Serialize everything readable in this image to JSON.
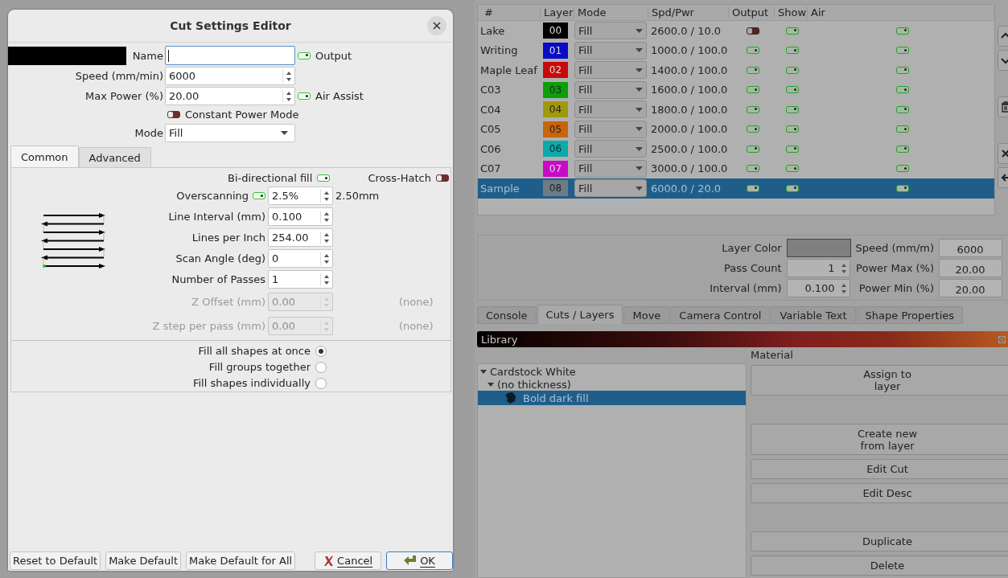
{
  "dialog": {
    "title": "Cut Settings Editor",
    "layer_swatch": {
      "color": "#000000"
    },
    "name": {
      "label": "Name"
    },
    "output": {
      "label": "Output",
      "on": true
    },
    "speed": {
      "label": "Speed (mm/min)",
      "value": "6000"
    },
    "max_power": {
      "label": "Max Power (%)",
      "value": "20.00"
    },
    "air_assist": {
      "label": "Air Assist",
      "on": true
    },
    "constant_power": {
      "label": "Constant Power Mode",
      "on": false
    },
    "mode": {
      "label": "Mode",
      "value": "Fill"
    },
    "tabs": [
      {
        "label": "Common",
        "selected": true
      },
      {
        "label": "Advanced",
        "selected": false
      }
    ],
    "bidirectional": {
      "label": "Bi-directional fill",
      "on": true
    },
    "cross_hatch": {
      "label": "Cross-Hatch",
      "on": false
    },
    "params": [
      {
        "label": "Overscanning",
        "value": "2.5%",
        "on": true,
        "suffix": "2.50mm",
        "disabled": false
      },
      {
        "label": "Line Interval (mm)",
        "value": "0.100",
        "disabled": false
      },
      {
        "label": "Lines per Inch",
        "value": "254.00",
        "disabled": false
      },
      {
        "label": "Scan Angle (deg)",
        "value": "0",
        "disabled": false
      },
      {
        "label": "Number of Passes",
        "value": "1",
        "disabled": false
      },
      {
        "label": "Z Offset (mm)",
        "value": "0.00",
        "note": "(none)",
        "disabled": true
      },
      {
        "label": "Z step per pass (mm)",
        "value": "0.00",
        "note": "(none)",
        "disabled": true
      }
    ],
    "fill_order": [
      {
        "label": "Fill all shapes at once",
        "selected": true
      },
      {
        "label": "Fill groups together",
        "selected": false
      },
      {
        "label": "Fill shapes individually",
        "selected": false
      }
    ],
    "buttons": [
      {
        "label": "Reset to Default",
        "kind": "plain"
      },
      {
        "label": "Make Default",
        "kind": "plain"
      },
      {
        "label": "Make Default for All",
        "kind": "plain"
      },
      {
        "label": "Cancel",
        "kind": "cancel"
      },
      {
        "label": "OK",
        "kind": "ok"
      }
    ]
  },
  "layers": {
    "columns": [
      "#",
      "Layer",
      "Mode",
      "Spd/Pwr",
      "Output",
      "Show",
      "Air"
    ],
    "rows": [
      {
        "name": "Lake",
        "layer": "00",
        "color": "#000000",
        "mode": "Fill",
        "spd_pwr": "2600.0 / 10.0",
        "output": false,
        "show": true,
        "air": true,
        "selected": false
      },
      {
        "name": "Writing",
        "layer": "01",
        "color": "#0a0ac8",
        "mode": "Fill",
        "spd_pwr": "1000.0 / 100.0",
        "output": true,
        "show": true,
        "air": true,
        "selected": false
      },
      {
        "name": "Maple Leaf",
        "layer": "02",
        "color": "#c80a0a",
        "mode": "Fill",
        "spd_pwr": "1400.0 / 100.0",
        "output": true,
        "show": true,
        "air": true,
        "selected": false
      },
      {
        "name": "C03",
        "layer": "03",
        "color": "#0aa00a",
        "mode": "Fill",
        "spd_pwr": "1600.0 / 100.0",
        "output": true,
        "show": true,
        "air": true,
        "selected": false
      },
      {
        "name": "C04",
        "layer": "04",
        "color": "#a09a0a",
        "mode": "Fill",
        "spd_pwr": "1800.0 / 100.0",
        "output": true,
        "show": true,
        "air": true,
        "selected": false
      },
      {
        "name": "C05",
        "layer": "05",
        "color": "#c8640a",
        "mode": "Fill",
        "spd_pwr": "2000.0 / 100.0",
        "output": true,
        "show": true,
        "air": true,
        "selected": false
      },
      {
        "name": "C06",
        "layer": "06",
        "color": "#0aaaaa",
        "mode": "Fill",
        "spd_pwr": "2500.0 / 100.0",
        "output": true,
        "show": true,
        "air": true,
        "selected": false
      },
      {
        "name": "C07",
        "layer": "07",
        "color": "#c80ac8",
        "mode": "Fill",
        "spd_pwr": "3000.0 / 100.0",
        "output": true,
        "show": true,
        "air": true,
        "selected": false
      },
      {
        "name": "Sample",
        "layer": "08",
        "color": "#6e7c88",
        "mode": "Fill",
        "spd_pwr": "6000.0 / 20.0",
        "output": true,
        "show": true,
        "air": true,
        "selected": true
      }
    ]
  },
  "layer_settings": {
    "layer_color": {
      "label": "Layer Color",
      "color": "#808080"
    },
    "fields": [
      {
        "label": "Speed (mm/m)",
        "value": "6000"
      },
      {
        "label": "Pass Count",
        "value": "1"
      },
      {
        "label": "Power Max (%)",
        "value": "20.00"
      },
      {
        "label": "Interval (mm)",
        "value": "0.100"
      },
      {
        "label": "Power Min (%)",
        "value": "20.00"
      }
    ]
  },
  "bottom_tabs": [
    {
      "label": "Console",
      "selected": false
    },
    {
      "label": "Cuts / Layers",
      "selected": true
    },
    {
      "label": "Move",
      "selected": false
    },
    {
      "label": "Camera Control",
      "selected": false
    },
    {
      "label": "Variable Text",
      "selected": false
    },
    {
      "label": "Shape Properties",
      "selected": false
    }
  ],
  "library": {
    "title": "Library",
    "material_label": "Material",
    "tree": [
      {
        "label": "Cardstock White",
        "expanded": true,
        "selected": false,
        "children": [
          {
            "label": "(no thickness)",
            "expanded": true,
            "selected": false,
            "children": [
              {
                "label": "Bold dark fill",
                "selected": true
              }
            ]
          }
        ]
      }
    ],
    "buttons": [
      "Assign to\nlayer",
      "Create new\nfrom layer",
      "Edit Cut",
      "Edit Desc",
      "Duplicate",
      "Delete"
    ]
  }
}
